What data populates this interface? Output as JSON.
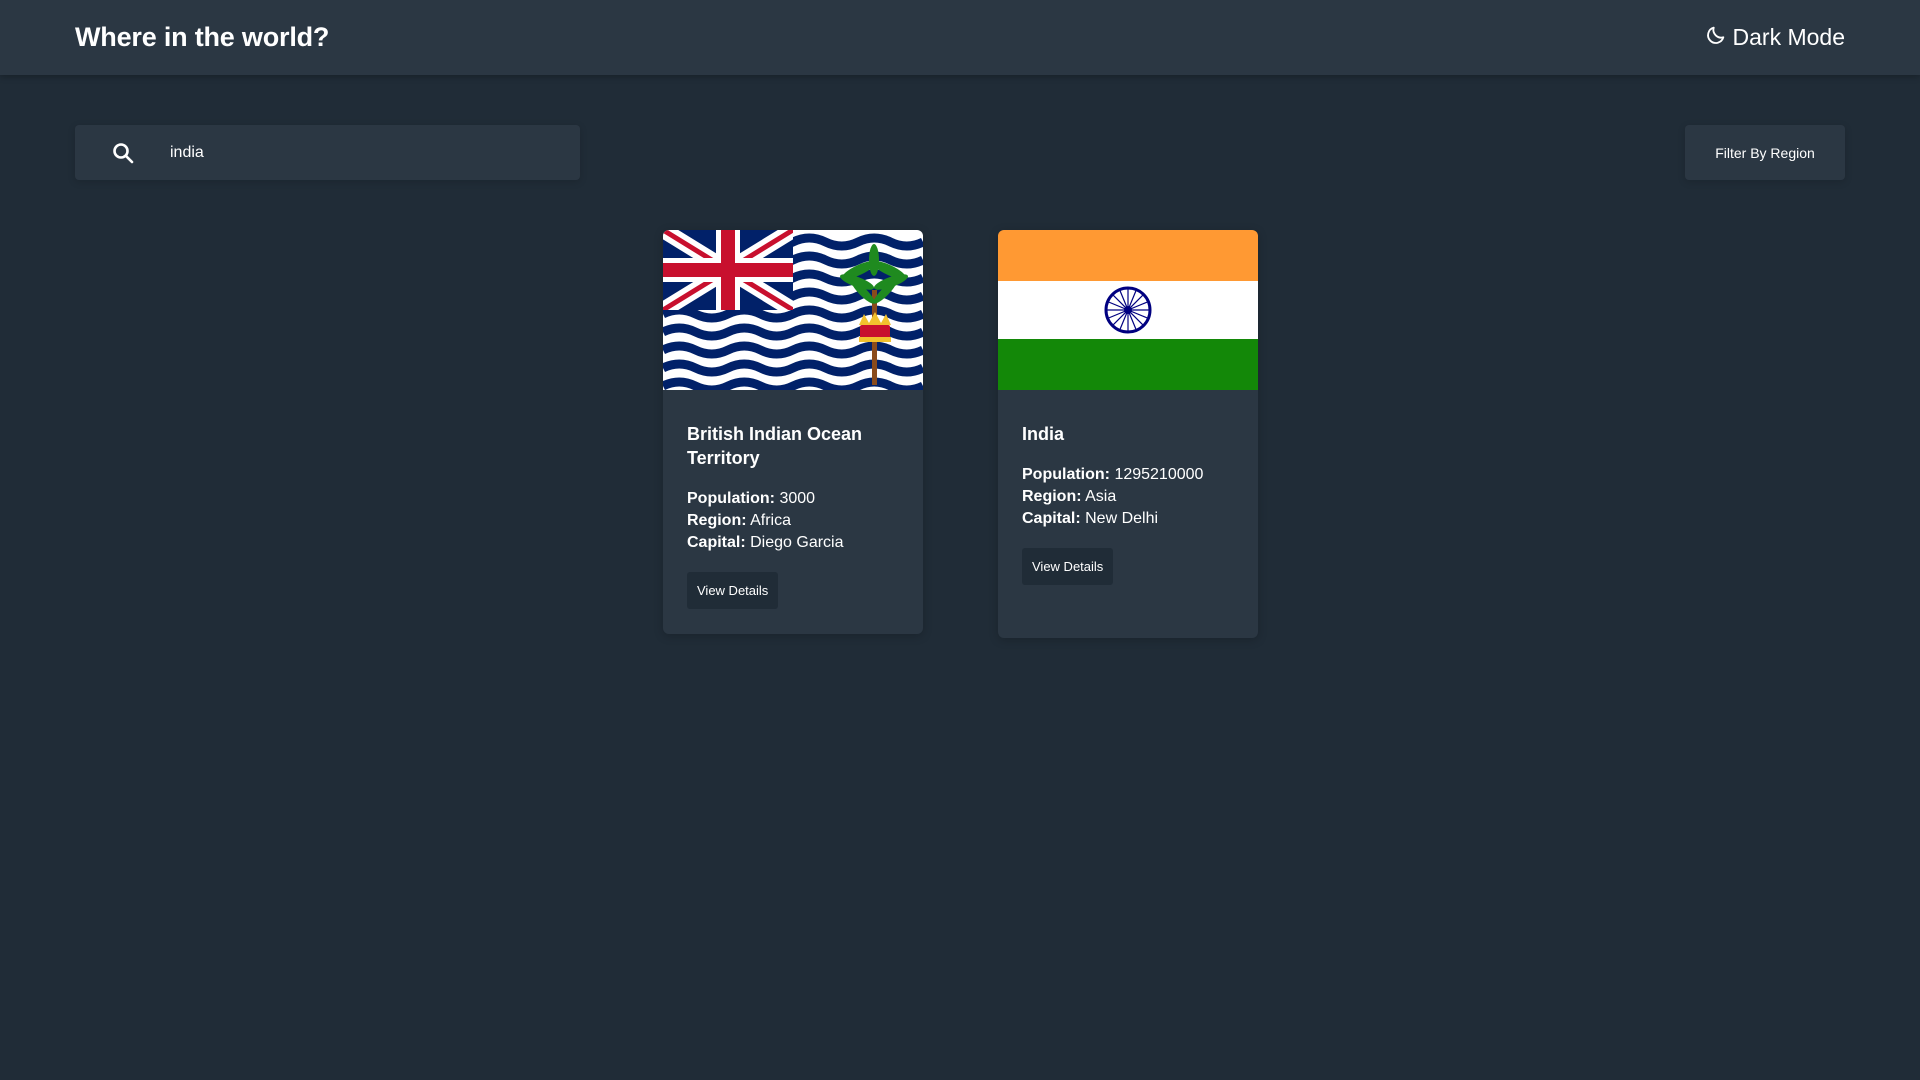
{
  "header": {
    "title": "Where in the world?",
    "theme_toggle_label": "Dark Mode"
  },
  "search": {
    "value": "india",
    "placeholder": ""
  },
  "filter": {
    "label": "Filter By Region"
  },
  "labels": {
    "population": "Population:",
    "region": "Region:",
    "capital": "Capital:"
  },
  "cards": [
    {
      "name_line1": "British Indian Ocean",
      "name_line2": "Territory",
      "population": "3000",
      "region": "Africa",
      "capital": "Diego Garcia",
      "button": "View Details"
    },
    {
      "name_line1": "India",
      "population": "1295210000",
      "region": "Asia",
      "capital": "New Delhi",
      "button": "View Details"
    }
  ],
  "colors": {
    "background": "#202c37",
    "element": "#2b3743",
    "text": "#ffffff"
  }
}
